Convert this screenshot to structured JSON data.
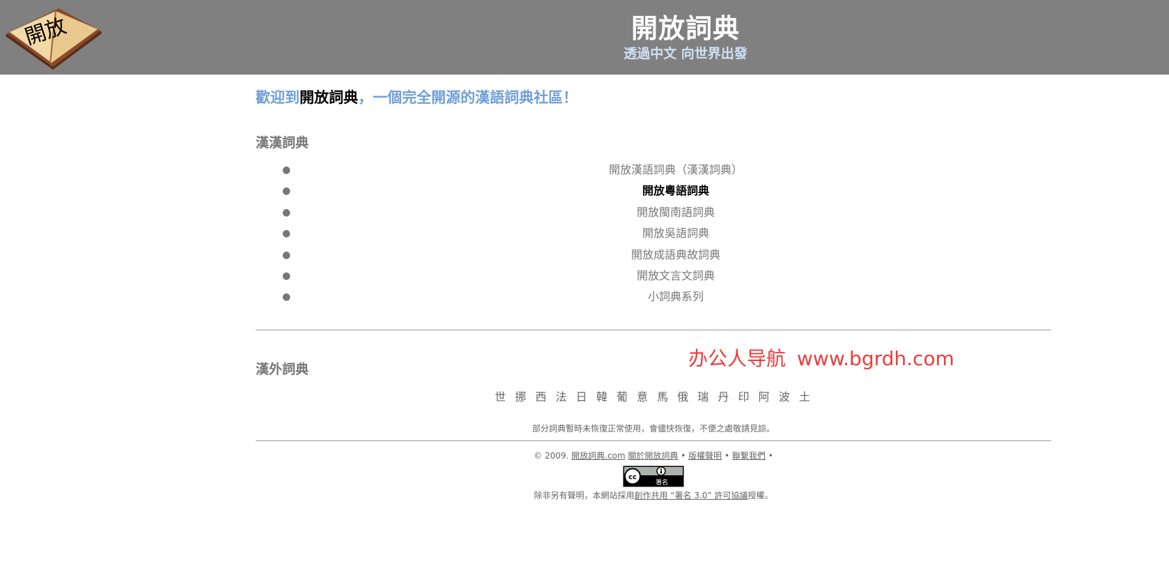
{
  "header": {
    "logo_text": "開放",
    "title": "開放詞典",
    "subtitle": "透過中文 向世界出發"
  },
  "welcome": {
    "prefix": "歡迎到",
    "brand": "開放詞典",
    "suffix": "，一個完全開源的漢語詞典社區！"
  },
  "han_section": {
    "heading": "漢漢詞典",
    "items": [
      {
        "label": "開放漢語詞典（漢漢詞典）",
        "current": false
      },
      {
        "label": "開放粵語詞典",
        "current": true
      },
      {
        "label": "開放閩南語詞典",
        "current": false
      },
      {
        "label": "開放吳語詞典",
        "current": false
      },
      {
        "label": "開放成語典故詞典",
        "current": false
      },
      {
        "label": "開放文言文詞典",
        "current": false
      },
      {
        "label": "小詞典系列",
        "current": false
      }
    ]
  },
  "foreign_section": {
    "heading": "漢外詞典",
    "languages": [
      "世",
      "挪",
      "西",
      "法",
      "日",
      "韓",
      "葡",
      "意",
      "馬",
      "俄",
      "瑞",
      "丹",
      "印",
      "阿",
      "波",
      "土"
    ]
  },
  "notice": "部分詞典暫時未恢復正常使用，會儘快恢復，不便之處敬請見諒。",
  "footer": {
    "copyright": "© 2009.",
    "site_link": "開放詞典.com",
    "about_link": "關於開放詞典",
    "copyright_link": "版權聲明",
    "contact_link": "聯繫我們",
    "separator": "•",
    "cc_badge": {
      "left": "cc",
      "right": "署名"
    },
    "license_prefix": "除非另有聲明，本網站採用",
    "license_link": "創作共用 “署名 3.0” 許可協議",
    "license_suffix": "授權。"
  },
  "watermark": {
    "text": "办公人导航",
    "url": "www.bgrdh.com"
  },
  "colors": {
    "header_bg": "#808080",
    "accent_blue": "#6f9fd8",
    "watermark_red": "#ee3b3b"
  }
}
